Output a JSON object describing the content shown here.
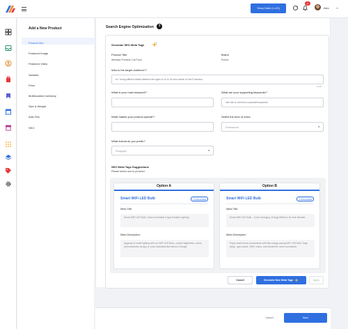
{
  "topbar": {
    "setup_label": "Setup Guide (1 of 5)",
    "notification_count": "11",
    "user_name": "Alex"
  },
  "left_panel": {
    "title": "Add a New Product",
    "items": [
      {
        "label": "Product Info",
        "active": true
      },
      {
        "label": "Featured Image",
        "active": false
      },
      {
        "label": "Featured Video",
        "active": false
      },
      {
        "label": "Variants",
        "active": false
      },
      {
        "label": "Price",
        "active": false
      },
      {
        "label": "Multilocation Inventory",
        "active": false
      },
      {
        "label": "Size & Weight",
        "active": false
      },
      {
        "label": "Add-Ons",
        "active": false
      },
      {
        "label": "SEO",
        "active": false
      }
    ]
  },
  "seo": {
    "section_title": "Search Engine Optimization",
    "panel_title": "Generate SEO Meta Tags",
    "product_title_label": "Product Title",
    "product_title_value": "Whiskas Premium Cat Food",
    "brand_label": "Brand",
    "brand_value": "Purina",
    "audience_label": "Who is the target audience?",
    "audience_placeholder": "ex. Young affluent adults between the ages of 24 to 30 who reside in San Francisco",
    "audience_counter": "0/128",
    "main_keyword_label": "What is your main keyword?",
    "supporting_keywords_label": "What are your supporting keywords?",
    "supporting_keywords_placeholder": "Use tab or comma to separate keywords",
    "special_label": "What makes your product special?",
    "tone_label": "Select the tone of voice.",
    "tone_value": "Professional",
    "format_label": "What format do you prefer?",
    "format_value": "Paragraph",
    "suggestions_title": "SEO Meta Tags Suggestions",
    "suggestions_subtitle": "Please select one to proceed.",
    "options": [
      {
        "header": "Option A",
        "name": "Smart WiFi LED Bulb",
        "badge": "✦ AI Generated",
        "meta_title_label": "Meta Title",
        "meta_title": "Smart WiFi LED Bulb | Voice-Controlled & App-Enabled Lighting",
        "meta_description_label": "Meta Description",
        "meta_description": "Upgrade to smart lighting with our WiFi LED Bulb—control brightness, colors, and schedules via app or voice assistants like Alexa & Google."
      },
      {
        "header": "Option B",
        "name": "Smart WiFi LED Bulb",
        "badge": "✦ AI Generated",
        "meta_title_label": "Meta Title",
        "meta_title": "Smart WiFi LED Bulb – Color-Changing, Energy Efficient, No Hub Needed",
        "meta_description_label": "Meta Description",
        "meta_description": "Enjoy smart home convenience with this energy-saving WiFi LED Bulb. Easy setup, app control, 16M+ colors, and hands-free voice commands."
      }
    ],
    "cancel_label": "Cancel",
    "generate_label": "Generate New Meta Tags",
    "apply_label": "Apply"
  },
  "footer": {
    "cancel_label": "Cancel",
    "save_label": "Save"
  },
  "colors": {
    "accent": "#2f6fe0",
    "badge_red": "#e5383b",
    "background": "#f1f2f6"
  }
}
